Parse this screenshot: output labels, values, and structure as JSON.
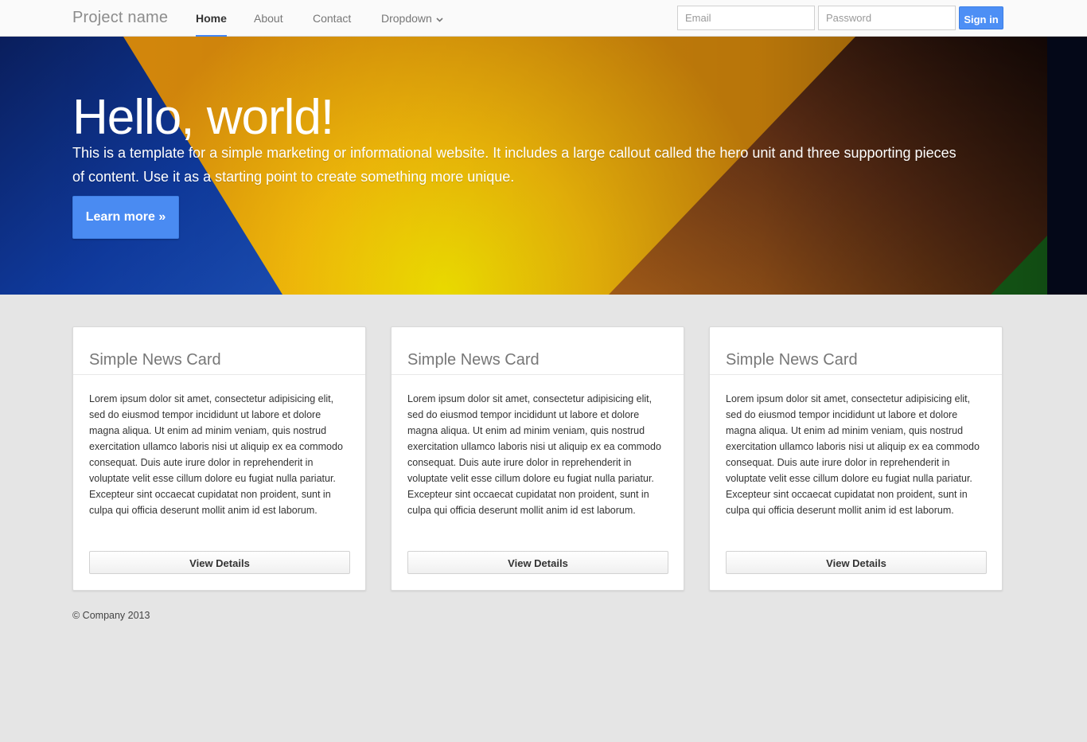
{
  "navbar": {
    "brand": "Project name",
    "items": [
      {
        "label": "Home",
        "active": true
      },
      {
        "label": "About",
        "active": false
      },
      {
        "label": "Contact",
        "active": false
      },
      {
        "label": "Dropdown",
        "active": false,
        "icon": "chevron-down-icon"
      }
    ],
    "email_placeholder": "Email",
    "password_placeholder": "Password",
    "signin_label": "Sign in"
  },
  "hero": {
    "title": "Hello, world!",
    "text": "This is a template for a simple marketing or informational website. It includes a large callout called the hero unit and three supporting pieces of content. Use it as a starting point to create something more unique.",
    "button_label": "Learn more »"
  },
  "cards": [
    {
      "title": "Simple News Card",
      "body": "Lorem ipsum dolor sit amet, consectetur adipisicing elit, sed do eiusmod tempor incididunt ut labore et dolore magna aliqua. Ut enim ad minim veniam, quis nostrud exercitation ullamco laboris nisi ut aliquip ex ea commodo consequat. Duis aute irure dolor in reprehenderit in voluptate velit esse cillum dolore eu fugiat nulla pariatur. Excepteur sint occaecat cupidatat non proident, sunt in culpa qui officia deserunt mollit anim id est laborum.",
      "button_label": "View Details"
    },
    {
      "title": "Simple News Card",
      "body": "Lorem ipsum dolor sit amet, consectetur adipisicing elit, sed do eiusmod tempor incididunt ut labore et dolore magna aliqua. Ut enim ad minim veniam, quis nostrud exercitation ullamco laboris nisi ut aliquip ex ea commodo consequat. Duis aute irure dolor in reprehenderit in voluptate velit esse cillum dolore eu fugiat nulla pariatur. Excepteur sint occaecat cupidatat non proident, sunt in culpa qui officia deserunt mollit anim id est laborum.",
      "button_label": "View Details"
    },
    {
      "title": "Simple News Card",
      "body": "Lorem ipsum dolor sit amet, consectetur adipisicing elit, sed do eiusmod tempor incididunt ut labore et dolore magna aliqua. Ut enim ad minim veniam, quis nostrud exercitation ullamco laboris nisi ut aliquip ex ea commodo consequat. Duis aute irure dolor in reprehenderit in voluptate velit esse cillum dolore eu fugiat nulla pariatur. Excepteur sint occaecat cupidatat non proident, sunt in culpa qui officia deserunt mollit anim id est laborum.",
      "button_label": "View Details"
    }
  ],
  "footer": {
    "text": "© Company 2013"
  },
  "colors": {
    "accent": "#4285f4",
    "page_background": "#e5e5e5",
    "navbar_background": "#fafafa"
  }
}
